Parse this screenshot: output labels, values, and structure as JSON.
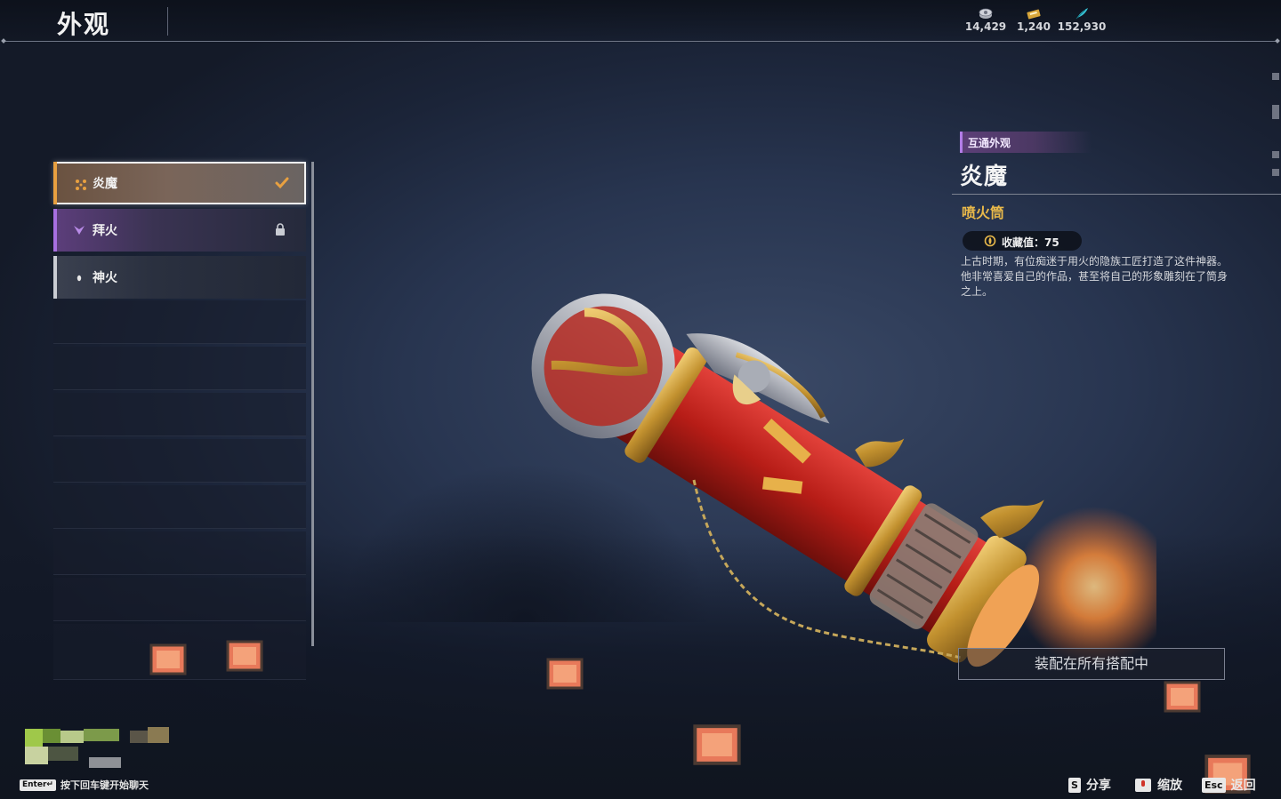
{
  "header": {
    "title": "外观",
    "currencies": [
      {
        "icon": "coin-stack-icon",
        "value": "14,429"
      },
      {
        "icon": "ticket-icon",
        "value": "1,240"
      },
      {
        "icon": "feather-icon",
        "value": "152,930"
      }
    ]
  },
  "skin_list": {
    "items": [
      {
        "label": "炎魔",
        "state": "selected-equipped",
        "accent": "#e8a040"
      },
      {
        "label": "拜火",
        "state": "locked",
        "accent": "#a76fe0"
      },
      {
        "label": "神火",
        "state": "available",
        "accent": "#c9ccd3"
      }
    ]
  },
  "detail": {
    "tag": "互通外观",
    "name": "炎魔",
    "type": "喷火筒",
    "collect_value": "收藏值：75",
    "description": "上古时期，有位痴迷于用火的隐族工匠打造了这件神器。他非常喜爱自己的作品，甚至将自己的形象雕刻在了筒身之上。",
    "equip_button": "装配在所有搭配中"
  },
  "footer": {
    "chat_key": "Enter↵",
    "chat_hint": "按下回车键开始聊天",
    "actions": [
      {
        "key": "S",
        "label": "分享"
      },
      {
        "key": "",
        "label": "缩放"
      },
      {
        "key": "Esc",
        "label": "返回"
      }
    ]
  },
  "colors": {
    "accent_gold": "#e9b94a",
    "purple_tag": "#b37de8",
    "weapon_red": "#c4261c"
  }
}
